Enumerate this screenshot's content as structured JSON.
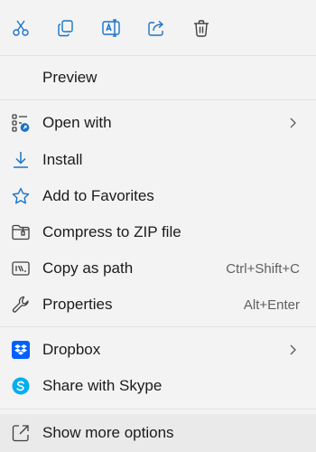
{
  "toolbar": {
    "icons": [
      "cut-icon",
      "copy-icon",
      "rename-icon",
      "share-icon",
      "delete-icon"
    ]
  },
  "items": [
    {
      "label": "Preview"
    },
    {
      "label": "Open with"
    },
    {
      "label": "Install"
    },
    {
      "label": "Add to Favorites"
    },
    {
      "label": "Compress to ZIP file"
    },
    {
      "label": "Copy as path",
      "shortcut": "Ctrl+Shift+C"
    },
    {
      "label": "Properties",
      "shortcut": "Alt+Enter"
    },
    {
      "label": "Dropbox"
    },
    {
      "label": "Share with Skype"
    },
    {
      "label": "Show more options"
    }
  ],
  "colors": {
    "accent": "#1a73c8",
    "dropbox": "#0061fe",
    "skype": "#00aff0",
    "background": "#f3f3f3"
  }
}
